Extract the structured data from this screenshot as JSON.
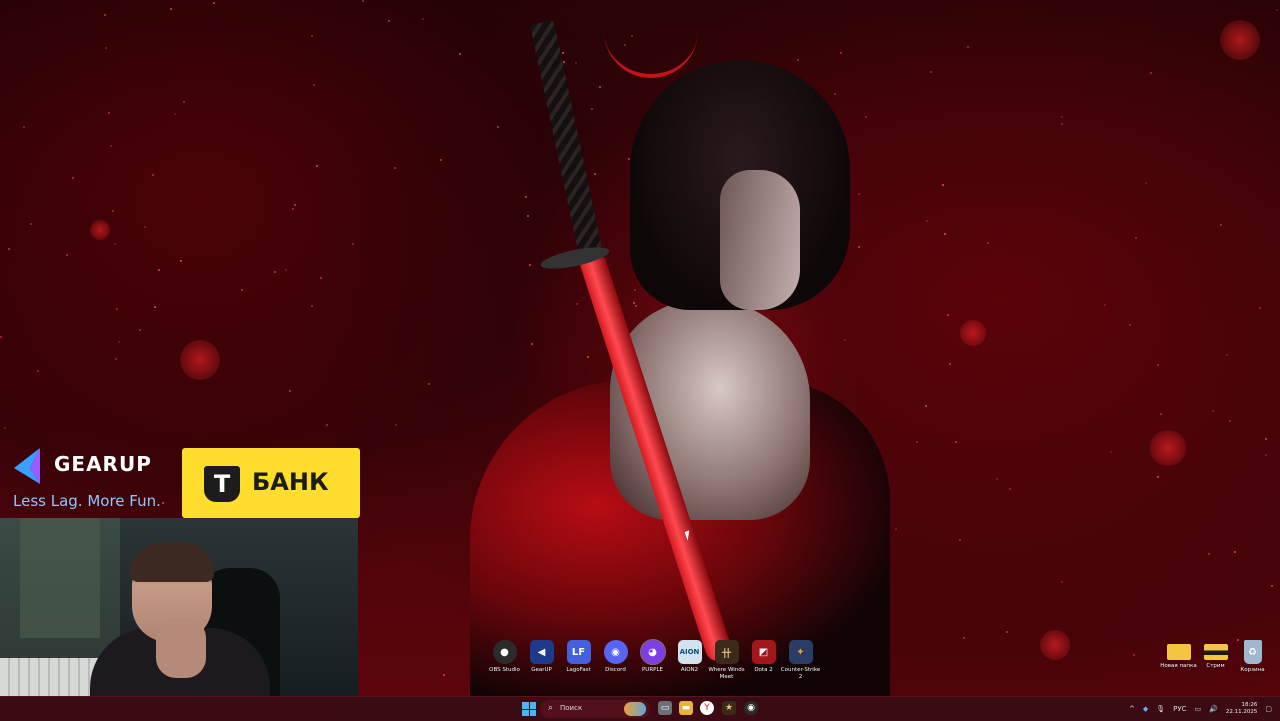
{
  "sponsors": {
    "gearup": {
      "name": "GEARUP",
      "slogan": "Less Lag. More Fun."
    },
    "tbank": {
      "letter": "T",
      "name": "БАНК"
    }
  },
  "desktop_icons": [
    {
      "label": "OBS Studio",
      "icon": "obs-icon",
      "color": "#2b2b2b"
    },
    {
      "label": "GearUP",
      "icon": "gearup-icon",
      "color": "#1e3a8a"
    },
    {
      "label": "LagoFast",
      "icon": "lagofast-icon",
      "color": "#4460e0"
    },
    {
      "label": "Discord",
      "icon": "discord-icon",
      "color": "#5865f2"
    },
    {
      "label": "PURPLE",
      "icon": "purple-icon",
      "color": "#7b3fe4"
    },
    {
      "label": "AION2",
      "icon": "aion2-icon",
      "color": "#cfe4ee"
    },
    {
      "label": "Where Winds Meet",
      "icon": "where-winds-meet-icon",
      "color": "#3a2a1a"
    },
    {
      "label": "Dota 2",
      "icon": "dota2-icon",
      "color": "#a3161a"
    },
    {
      "label": "Counter-Strike 2",
      "icon": "cs2-icon",
      "color": "#2a3d66"
    }
  ],
  "right_icons": [
    {
      "label": "Новая папка",
      "icon": "folder-icon",
      "color": "#f5c542"
    },
    {
      "label": "Стрим",
      "icon": "folder-icon",
      "color": "#f5c542"
    },
    {
      "label": "Корзина",
      "icon": "recycle-bin-icon",
      "color": "#9fb8d0"
    }
  ],
  "taskbar": {
    "search_placeholder": "Поиск",
    "tray_lang": "РУС",
    "time": "18:26",
    "date": "22.11.2025"
  }
}
